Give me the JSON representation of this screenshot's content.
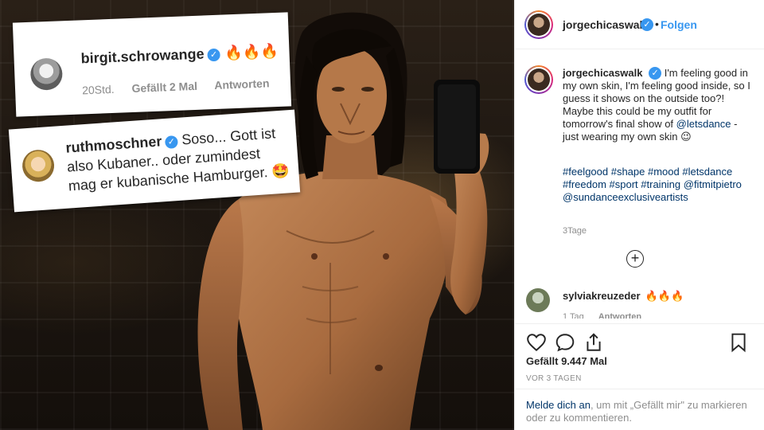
{
  "overlay_comments": [
    {
      "username": "birgit.schrowange",
      "text": "🔥🔥🔥",
      "time": "20Std.",
      "likes": "Gefällt 2 Mal",
      "reply": "Antworten"
    },
    {
      "username": "ruthmoschner",
      "text": "Soso... Gott ist also Kubaner.. oder zumindest mag er kubanische Hamburger. 🤩"
    }
  ],
  "post": {
    "header": {
      "username": "jorgechicaswalk",
      "separator": "•",
      "follow_label": "Folgen"
    },
    "caption": {
      "username": "jorgechicaswalk",
      "text_before_link": "I'm feeling good in my own skin, I'm feeling good inside, so I guess it shows on the outside too?! Maybe this could be my outfit for tomorrow's final show of ",
      "link": "@letsdance",
      "text_after_link": " - just wearing my own skin 😉",
      "hashtags": "#feelgood #shape #mood #letsdance #freedom #sport #training @fitmitpietro @sundanceexclusiveartists",
      "age": "3Tage"
    },
    "load_more_icon": "plus-circle-icon",
    "comment": {
      "username": "sylviakreuzeder",
      "text": "🔥🔥🔥",
      "time": "1 Tag",
      "reply": "Antworten"
    },
    "actions": {
      "like_icon": "heart-icon",
      "comment_icon": "speech-bubble-icon",
      "share_icon": "share-icon",
      "save_icon": "bookmark-icon"
    },
    "likes": "Gefällt 9.447 Mal",
    "date": "VOR 3 TAGEN",
    "login_prompt": {
      "link": "Melde dich an",
      "rest": ", um mit „Gefällt mir\" zu markieren oder zu kommentieren."
    }
  },
  "colors": {
    "accent": "#3897f0",
    "link": "#003569",
    "muted": "#8e8e8e",
    "border": "#efefef"
  }
}
